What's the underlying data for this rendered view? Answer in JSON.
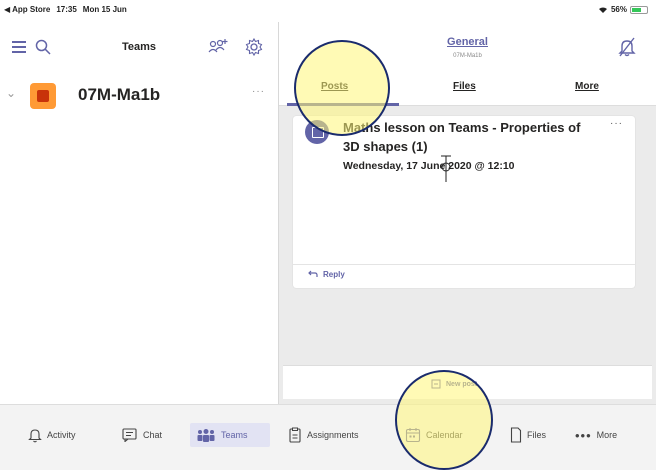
{
  "status_bar": {
    "back": "◀ App Store",
    "time": "17:35",
    "date": "Mon 15 Jun",
    "battery": "56%"
  },
  "left_pane": {
    "title": "Teams",
    "team": {
      "name": "07M-Ma1b",
      "more": "···"
    }
  },
  "channel": {
    "title": "General",
    "subtitle": "07M-Ma1b"
  },
  "tabs": [
    {
      "label": "Posts"
    },
    {
      "label": "Files"
    },
    {
      "label": "More"
    }
  ],
  "post": {
    "title": "Maths lesson on Teams - Properties of 3D shapes (1)",
    "date": "Wednesday, 17 June 2020 @ 12:10",
    "more": "···",
    "reply_label": "Reply"
  },
  "new_post": {
    "label": "New post"
  },
  "bottom_nav": [
    {
      "label": "Activity"
    },
    {
      "label": "Chat"
    },
    {
      "label": "Teams"
    },
    {
      "label": "Assignments"
    },
    {
      "label": "Calendar"
    },
    {
      "label": "Files"
    },
    {
      "label": "More"
    }
  ],
  "colors": {
    "accent": "#6264a7",
    "highlight": "#fff678",
    "highlight_ring": "#1a2b6d",
    "team_avatar": "#ff9a35"
  },
  "icons": [
    "hamburger-icon",
    "search-icon",
    "add-team-icon",
    "settings-icon",
    "bell-off-icon",
    "reply-icon",
    "new-post-icon",
    "activity-bell-icon",
    "chat-icon",
    "teams-icon",
    "assignments-icon",
    "calendar-icon",
    "files-icon",
    "more-dots-icon"
  ]
}
